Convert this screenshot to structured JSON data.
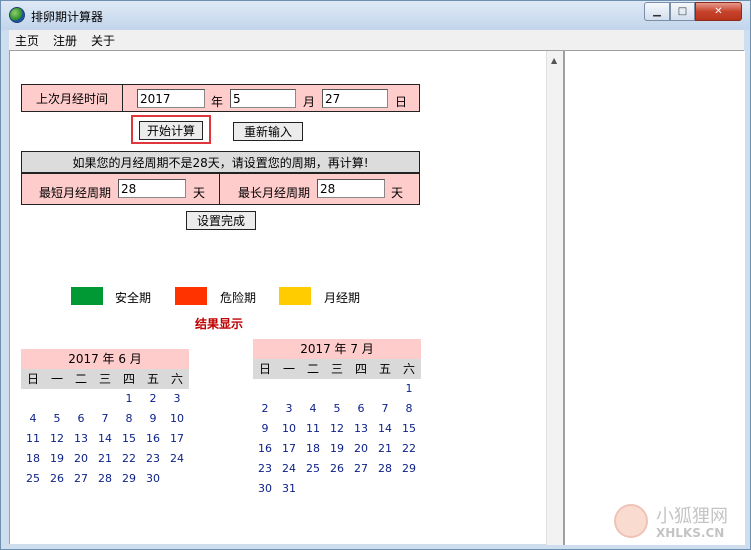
{
  "window": {
    "title": "排卵期计算器"
  },
  "menu": [
    "主页",
    "注册",
    "关于"
  ],
  "form": {
    "last_period_label": "上次月经时间",
    "year_value": "2017",
    "year_unit": "年",
    "month_value": "5",
    "month_unit": "月",
    "day_value": "27",
    "day_unit": "日",
    "start_button": "开始计算",
    "reset_button": "重新输入",
    "notice": "如果您的月经周期不是28天，请设置您的周期，再计算!",
    "min_cycle_label": "最短月经周期",
    "min_cycle_value": "28",
    "max_cycle_label": "最长月经周期",
    "max_cycle_value": "28",
    "day_unit2": "天",
    "confirm_button": "设置完成"
  },
  "legend": [
    {
      "label": "安全期",
      "color": "#009933"
    },
    {
      "label": "危险期",
      "color": "#ff3300"
    },
    {
      "label": "月经期",
      "color": "#ffcc00"
    }
  ],
  "result_label": "结果显示",
  "weekdays": [
    "日",
    "一",
    "二",
    "三",
    "四",
    "五",
    "六"
  ],
  "calendars": [
    {
      "title": "2017 年 6 月",
      "offset": 4,
      "days": 30
    },
    {
      "title": "2017 年 7 月",
      "offset": 6,
      "days": 31
    }
  ],
  "watermark": {
    "line1": "小狐狸网",
    "line2": "XHLKS.CN"
  }
}
